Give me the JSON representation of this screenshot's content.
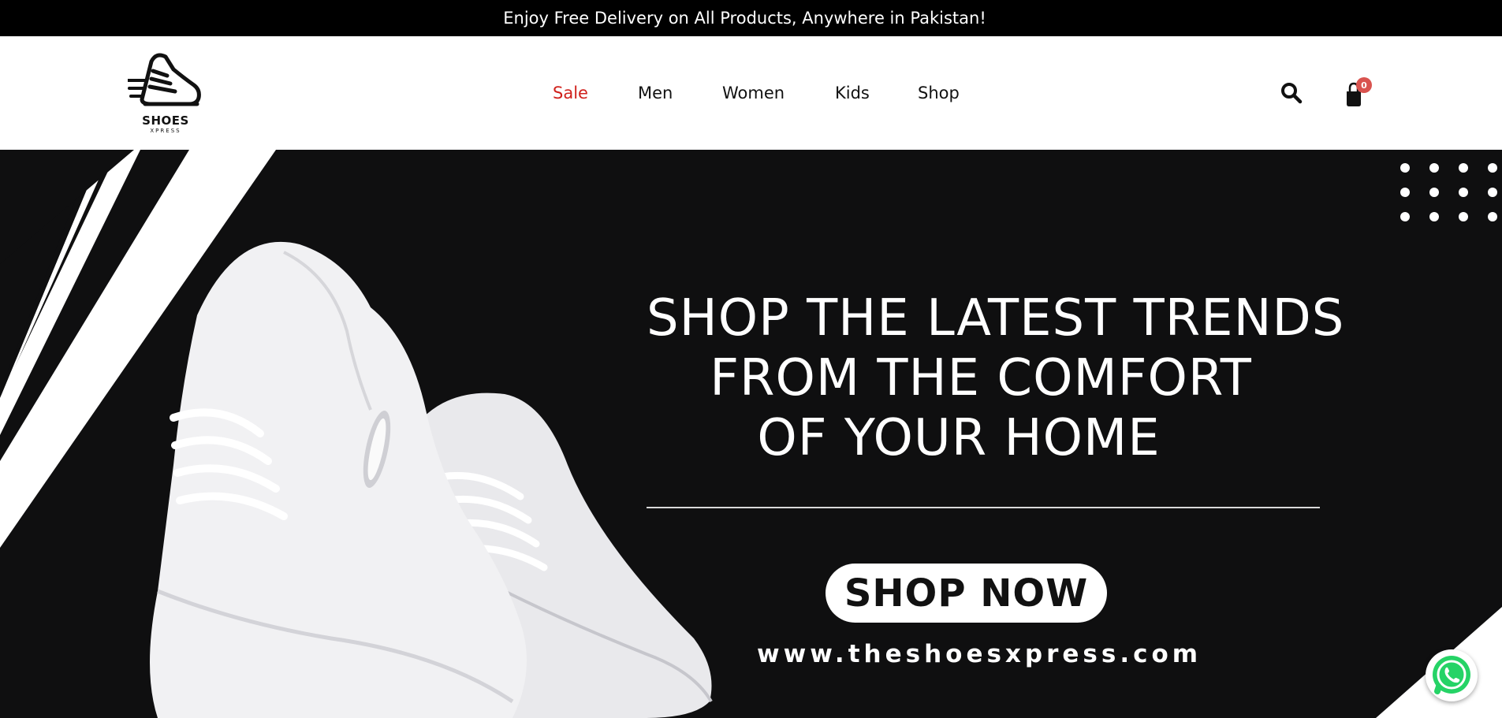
{
  "announcement": {
    "text": "Enjoy Free Delivery on All Products, Anywhere in Pakistan!"
  },
  "logo": {
    "brand": "SHOES",
    "sub": "XPRESS"
  },
  "nav": {
    "items": [
      {
        "label": "Sale"
      },
      {
        "label": "Men"
      },
      {
        "label": "Women"
      },
      {
        "label": "Kids"
      },
      {
        "label": "Shop"
      }
    ]
  },
  "header_actions": {
    "search_icon": "search-icon",
    "cart_icon": "shopping-bag-icon",
    "cart_count": "0"
  },
  "hero": {
    "headline_lines": [
      "SHOP THE LATEST TRENDS",
      "FROM THE COMFORT",
      "OF YOUR HOME"
    ],
    "cta_label": "SHOP NOW",
    "website": "www.theshoesxpress.com"
  },
  "widgets": {
    "whatsapp_icon": "whatsapp-icon"
  },
  "colors": {
    "sale": "#d0211c",
    "hero_bg": "#0f0f10",
    "cart_badge": "#d9534f",
    "whatsapp": "#25d366"
  }
}
